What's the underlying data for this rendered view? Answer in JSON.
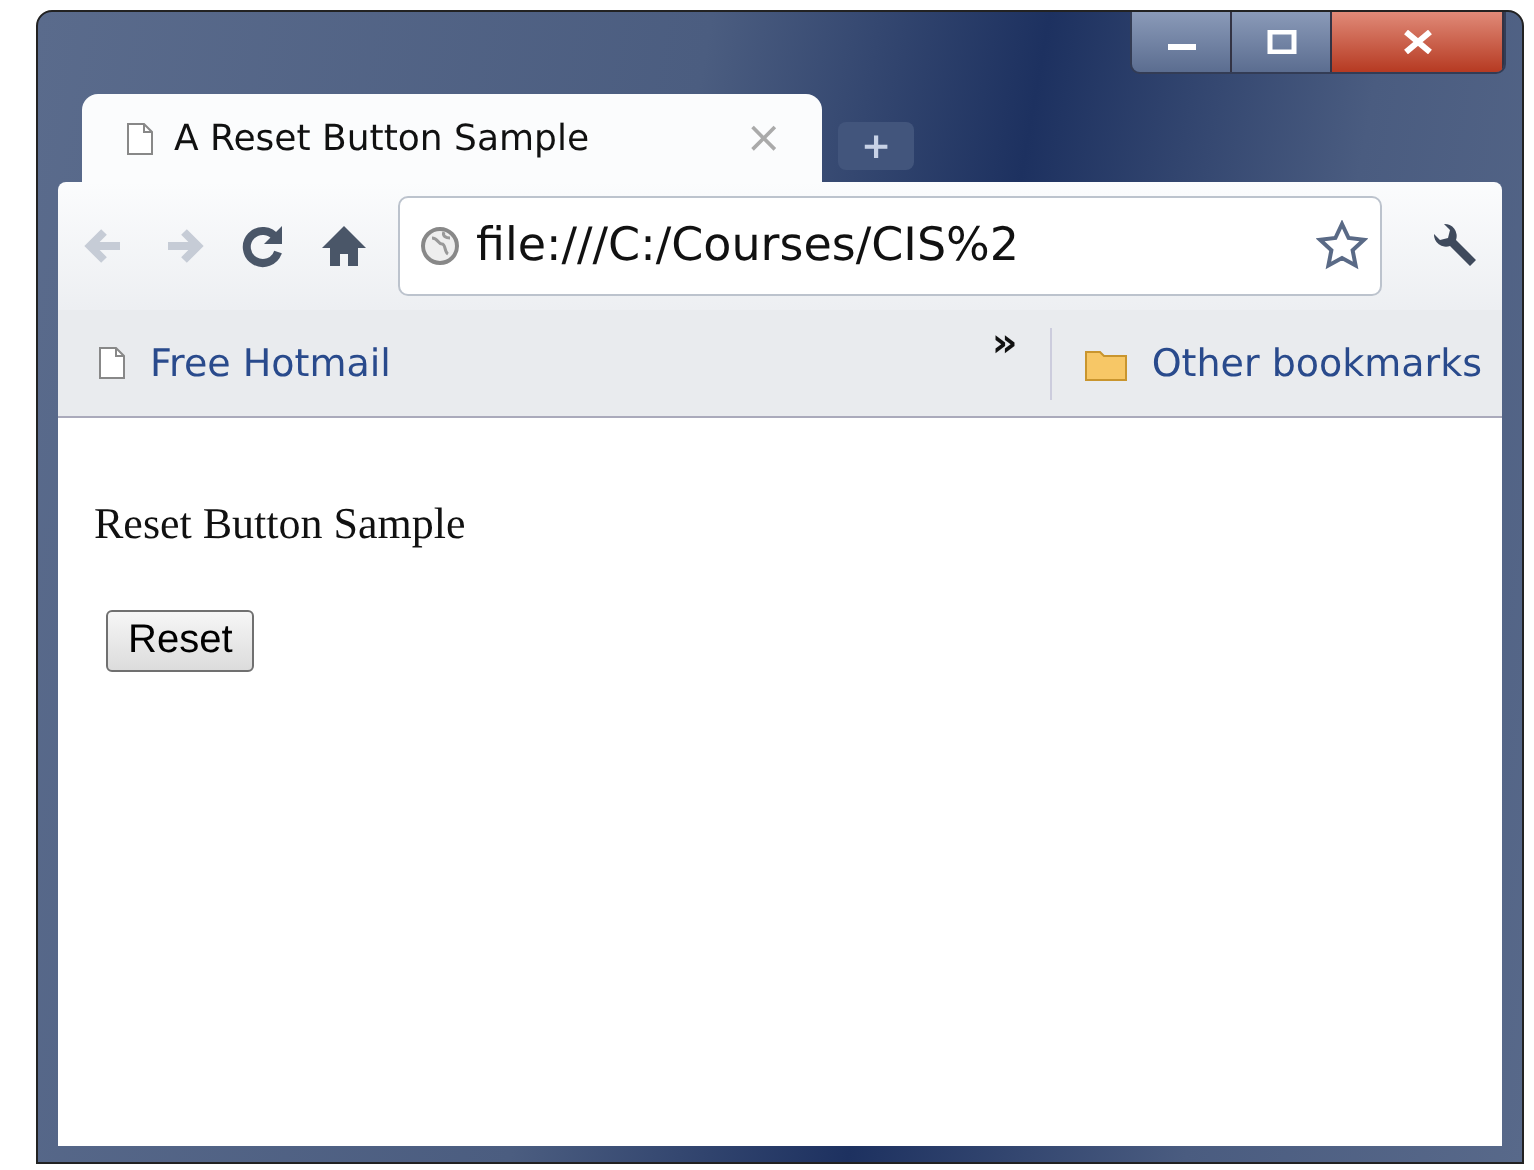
{
  "tabs": [
    {
      "title": "A Reset Button Sample",
      "close": "×",
      "selected": true
    }
  ],
  "new_tab": "+",
  "nav_buttons": [
    {
      "kind": "back",
      "disabled": true
    },
    {
      "kind": "forward",
      "disabled": true
    },
    {
      "kind": "reload",
      "disabled": false
    },
    {
      "kind": "home",
      "disabled": false
    }
  ],
  "address": {
    "value": "file:///C:/Courses/CIS%2"
  },
  "bookmarks": [
    {
      "label": "Free Hotmail"
    }
  ],
  "overflow": "»",
  "other_bookmarks": "Other bookmarks",
  "page": {
    "heading": "Reset Button Sample",
    "button": "Reset"
  }
}
